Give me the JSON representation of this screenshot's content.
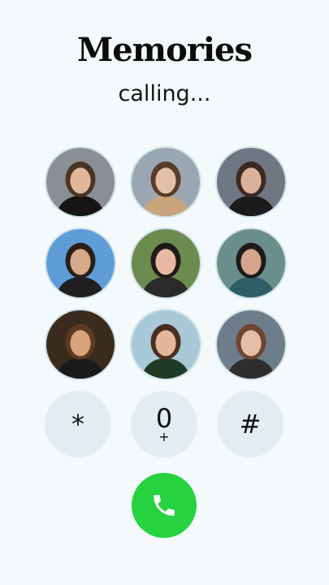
{
  "header": {
    "title": "Memories",
    "status": "calling..."
  },
  "photos": [
    {
      "icon": "photo-woman-coffee-icon",
      "bg": "#8a8f96",
      "skin": "#e1b79c",
      "hair": "#4a3426",
      "cloth": "#151515"
    },
    {
      "icon": "photo-woman-fur-coat-icon",
      "bg": "#9aa7b2",
      "skin": "#e3bfa6",
      "hair": "#5a3a28",
      "cloth": "#c9a47c"
    },
    {
      "icon": "photo-woman-bouquet-icon",
      "bg": "#6f7782",
      "skin": "#dcb19a",
      "hair": "#3b2a20",
      "cloth": "#1b1b1b"
    },
    {
      "icon": "photo-eiffel-tower-icon",
      "bg": "#5f9dd8",
      "skin": "#d8aa8c",
      "hair": "#2b1e16",
      "cloth": "#1f1f1f"
    },
    {
      "icon": "photo-woman-headband-icon",
      "bg": "#6c8b4f",
      "skin": "#e8b9a2",
      "hair": "#1e1a18",
      "cloth": "#2a2a2a"
    },
    {
      "icon": "photo-woman-camera-icon",
      "bg": "#6a8e8b",
      "skin": "#d4a58b",
      "hair": "#1d1b1a",
      "cloth": "#2f5d66"
    },
    {
      "icon": "photo-woman-night-lights-icon",
      "bg": "#3a2b1c",
      "skin": "#d8a27c",
      "hair": "#5a3b22",
      "cloth": "#1a1a1a"
    },
    {
      "icon": "photo-woman-bob-hair-icon",
      "bg": "#a9c9d9",
      "skin": "#e2b79a",
      "hair": "#4a2e1f",
      "cloth": "#1f3a25"
    },
    {
      "icon": "photo-woman-portrait-icon",
      "bg": "#6d7d8c",
      "skin": "#e6bea5",
      "hair": "#6e4630",
      "cloth": "#2e2e2e"
    }
  ],
  "keypad": {
    "star": "*",
    "zero": "0",
    "zero_sub": "+",
    "hash": "#"
  },
  "call": {
    "icon": "phone-icon",
    "color": "#27d241"
  }
}
